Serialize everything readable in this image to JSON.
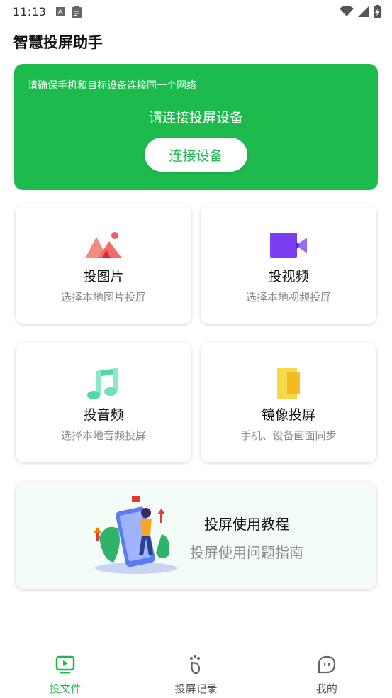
{
  "status_bar": {
    "time": "11:13"
  },
  "app": {
    "title": "智慧投屏助手"
  },
  "banner": {
    "hint": "请确保手机和目标设备连接同一个网络",
    "title": "请连接投屏设备",
    "connect_button": "连接设备"
  },
  "cards": [
    {
      "title": "投图片",
      "subtitle": "选择本地图片投屏",
      "icon": "image-icon"
    },
    {
      "title": "投视频",
      "subtitle": "选择本地视频投屏",
      "icon": "video-icon"
    },
    {
      "title": "投音频",
      "subtitle": "选择本地音频投屏",
      "icon": "music-icon"
    },
    {
      "title": "镜像投屏",
      "subtitle": "手机、设备画面同步",
      "icon": "mirror-icon"
    }
  ],
  "tutorial": {
    "title": "投屏使用教程",
    "subtitle": "投屏使用问题指南"
  },
  "bottom_nav": {
    "items": [
      {
        "label": "投文件",
        "icon": "tv-play-icon",
        "active": true
      },
      {
        "label": "投屏记录",
        "icon": "footprint-icon",
        "active": false
      },
      {
        "label": "我的",
        "icon": "profile-face-icon",
        "active": false
      }
    ]
  },
  "colors": {
    "accent": "#1dbb4e",
    "subtitle_gray": "#8a8a8a"
  }
}
